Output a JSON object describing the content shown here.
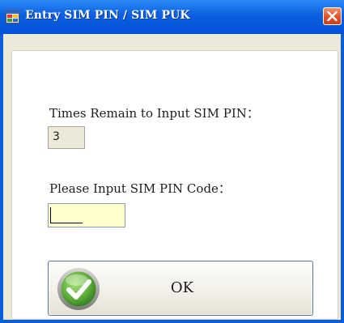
{
  "window": {
    "title": "Entry SIM PIN / SIM PUK",
    "app_icon": "app-window-icon",
    "close_icon": "close-icon"
  },
  "form": {
    "remain_label": "Times Remain to Input SIM PIN：",
    "remain_value": "3",
    "pin_label": "Please Input SIM PIN Code：",
    "pin_value": ""
  },
  "ok_button": {
    "label": "OK",
    "icon": "green-checkmark-icon"
  },
  "colors": {
    "titlebar": "#0b5ee0",
    "close_button": "#e2572c",
    "dialog_background": "#ece9d8",
    "pin_field_background": "#ffffcc",
    "checkmark": "#5fae3a"
  }
}
